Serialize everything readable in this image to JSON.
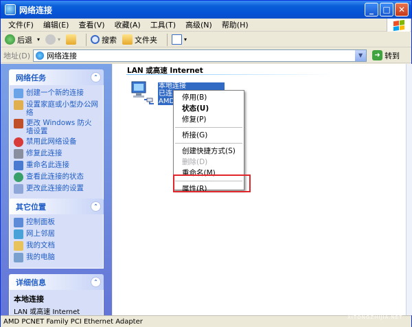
{
  "window": {
    "title": "网络连接"
  },
  "menu": [
    "文件(F)",
    "编辑(E)",
    "查看(V)",
    "收藏(A)",
    "工具(T)",
    "高级(N)",
    "帮助(H)"
  ],
  "toolbar": {
    "back": "后退",
    "search": "搜索",
    "folders": "文件夹"
  },
  "address": {
    "label": "地址(D)",
    "value": "网络连接",
    "go": "转到"
  },
  "left_pane": {
    "network_tasks": {
      "title": "网络任务",
      "items": [
        "创建一个新的连接",
        "设置家庭或小型办公网络",
        "更改 Windows 防火墙设置",
        "禁用此网络设备",
        "修复此连接",
        "重命名此连接",
        "查看此连接的状态",
        "更改此连接的设置"
      ]
    },
    "other_places": {
      "title": "其它位置",
      "items": [
        "控制面板",
        "网上邻居",
        "我的文档",
        "我的电脑"
      ]
    },
    "details": {
      "title": "详细信息",
      "name": "本地连接",
      "type": "LAN 或高速 Internet"
    }
  },
  "content": {
    "group_header": "LAN 或高速 Internet",
    "connection": {
      "name": "本地连接",
      "status": "已连",
      "adapter": "AMD"
    }
  },
  "context_menu": {
    "items": [
      {
        "label": "停用(B)",
        "style": "normal"
      },
      {
        "label": "状态(U)",
        "style": "bold"
      },
      {
        "label": "修复(P)",
        "style": "normal"
      },
      {
        "label": "桥接(G)",
        "style": "normal"
      },
      {
        "label": "创建快捷方式(S)",
        "style": "normal"
      },
      {
        "label": "删除(D)",
        "style": "disabled"
      },
      {
        "label": "重命名(M)",
        "style": "normal"
      },
      {
        "label": "属性(R)",
        "style": "normal"
      }
    ]
  },
  "status_bar": {
    "text": "AMD PCNET Family PCI Ethernet Adapter"
  },
  "watermark": {
    "text": "系统之家",
    "sub": "XITONGZHIJIA.NET"
  },
  "colors": {
    "title_blue": "#0553d6",
    "task_link": "#215dc6",
    "highlight_red": "#e0242a",
    "selection": "#316ac5"
  }
}
